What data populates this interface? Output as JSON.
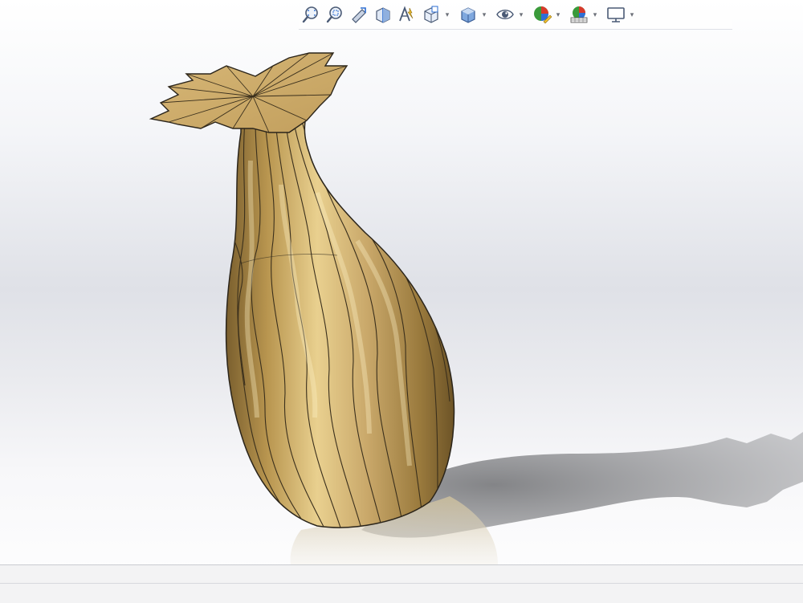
{
  "toolbar": {
    "items": [
      {
        "icon": "zoom-to-fit-icon",
        "has_dropdown": false
      },
      {
        "icon": "zoom-to-area-icon",
        "has_dropdown": false
      },
      {
        "icon": "previous-view-icon",
        "has_dropdown": false
      },
      {
        "icon": "section-view-icon",
        "has_dropdown": false
      },
      {
        "icon": "dynamic-annotation-icon",
        "has_dropdown": false
      },
      {
        "icon": "view-orientation-icon",
        "has_dropdown": true
      },
      {
        "icon": "display-style-icon",
        "has_dropdown": true
      },
      {
        "icon": "hide-show-items-icon",
        "has_dropdown": true
      },
      {
        "icon": "edit-appearance-icon",
        "has_dropdown": true
      },
      {
        "icon": "apply-scene-icon",
        "has_dropdown": true
      },
      {
        "icon": "view-settings-icon",
        "has_dropdown": true
      }
    ]
  },
  "colors": {
    "model_base": "#c9a86a",
    "model_light": "#f1dca5",
    "model_dark": "#7a5f2e",
    "edge": "#2a241a",
    "shadow": "#8e8e90"
  },
  "statusbar": {
    "text": ""
  }
}
